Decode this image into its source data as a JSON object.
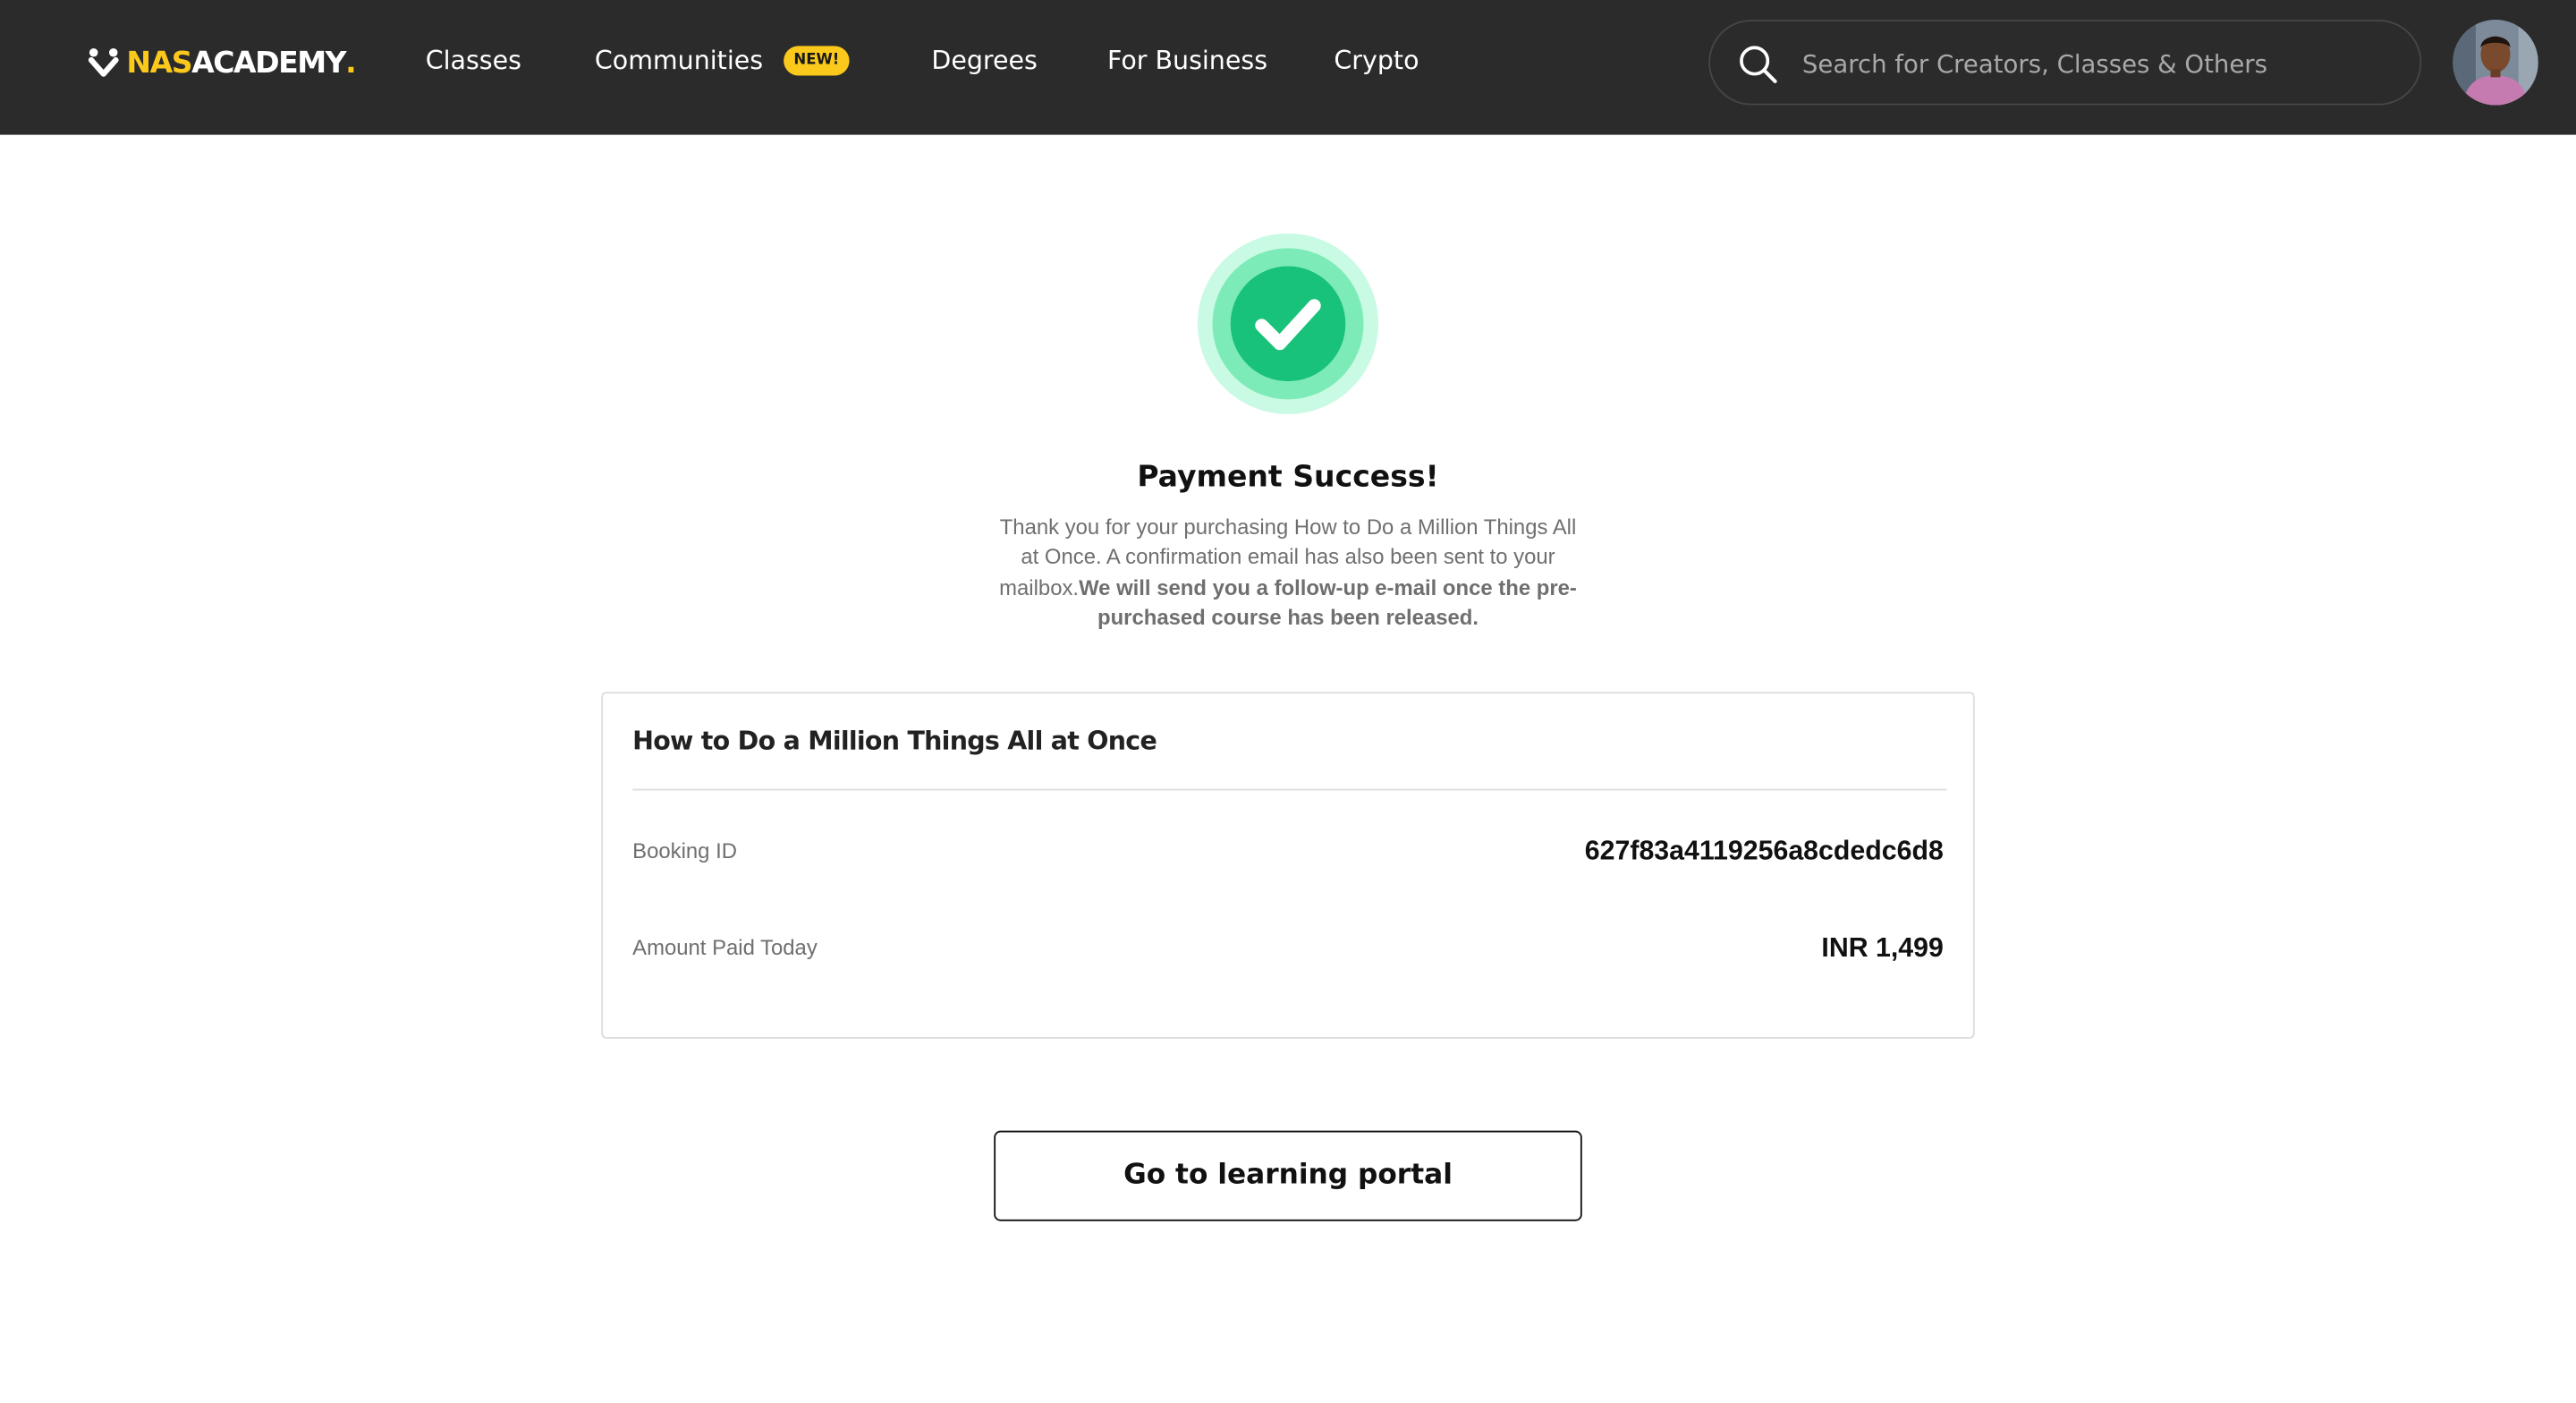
{
  "header": {
    "logo": {
      "nas": "NAS",
      "academy": "ACADEMY",
      "dot": "."
    },
    "nav": [
      {
        "label": "Classes"
      },
      {
        "label": "Communities"
      },
      {
        "label": "Degrees"
      },
      {
        "label": "For Business"
      },
      {
        "label": "Crypto"
      }
    ],
    "new_badge": "NEW!",
    "search": {
      "placeholder": "Search for Creators, Classes & Others"
    }
  },
  "main": {
    "title": "Payment Success!",
    "message": "Thank you for your purchasing How to Do a Million Things All at Once. A confirmation email has also been sent to your mailbox.",
    "message_bold": "We will send you a follow-up e-mail once the pre-purchased course has been released.",
    "card": {
      "course_title": "How to Do a Million Things All at Once",
      "rows": [
        {
          "label": "Booking ID",
          "value": "627f83a4119256a8cdedc6d8"
        },
        {
          "label": "Amount Paid Today",
          "value": "INR 1,499"
        }
      ]
    },
    "portal_button": "Go to learning portal"
  },
  "colors": {
    "header_bg": "#2b2b2b",
    "brand_yellow": "#fbc91b",
    "success_green": "#19c27a",
    "success_ring": "#c9fae3"
  }
}
